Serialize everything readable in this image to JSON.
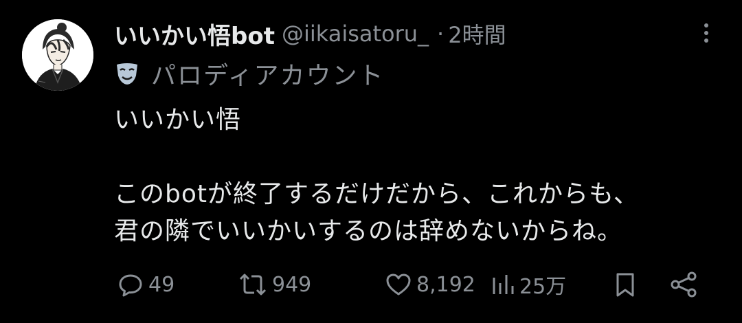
{
  "tweet": {
    "display_name": "いいかい悟bot",
    "handle": "@iikaisatoru_",
    "separator": "·",
    "time": "2時間",
    "parody_label": "パロディアカウント",
    "text_lines": [
      "いいかい悟",
      "",
      "このbotが終了するだけだから、これからも、",
      "君の隣でいいかいするのは辞めないからね。"
    ],
    "icons": {
      "avatar": "avatar-illustration",
      "more": "more-vertical-icon",
      "parody": "theater-mask-icon"
    }
  },
  "actions": {
    "reply": {
      "count": "49",
      "icon": "reply-icon"
    },
    "retweet": {
      "count": "949",
      "icon": "retweet-icon"
    },
    "like": {
      "count": "8,192",
      "icon": "heart-icon"
    },
    "views": {
      "count": "25万",
      "icon": "views-icon"
    },
    "bookmark": {
      "icon": "bookmark-icon"
    },
    "share": {
      "icon": "share-icon"
    }
  },
  "colors": {
    "background": "#000000",
    "primary_text": "#e7e9ea",
    "secondary_text": "#8b9096",
    "mask": "#b8c8d8"
  }
}
